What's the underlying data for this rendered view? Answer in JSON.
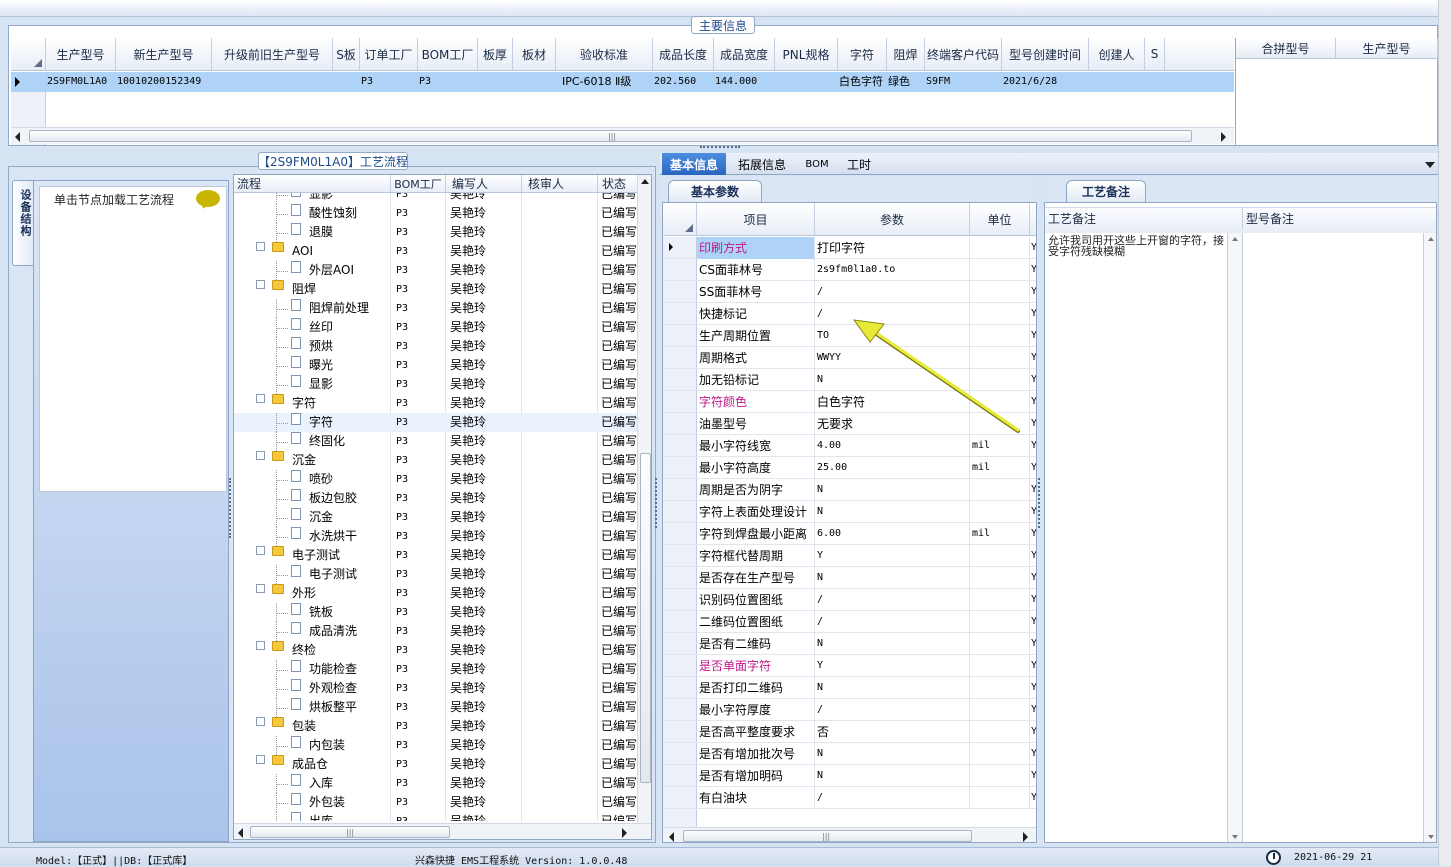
{
  "main_info": {
    "title": "主要信息",
    "columns": [
      "生产型号",
      "新生产型号",
      "升级前旧生产型号",
      "S板",
      "订单工厂",
      "BOM工厂",
      "板厚",
      "板材",
      "验收标准",
      "成品长度",
      "成品宽度",
      "PNL规格",
      "字符",
      "阻焊",
      "终端客户代码",
      "型号创建时间",
      "创建人",
      "S"
    ],
    "row": {
      "prod_model": "2S9FM0L1A0",
      "new_model": "10010200152349",
      "old_model": "",
      "s_board": "",
      "order_factory": "P3",
      "bom_factory": "P3",
      "thickness": "",
      "material": "",
      "standard": "IPC-6018 Ⅱ级",
      "length": "202.560",
      "width": "144.000",
      "pnl": "",
      "char": "白色字符",
      "mask": "绿色",
      "customer": "S9FM",
      "created": "2021/6/28",
      "creator": ""
    },
    "combo_columns": [
      "合拼型号",
      "生产型号"
    ]
  },
  "process": {
    "title": "【2S9FM0L1A0】工艺流程",
    "side_tab": "设备结构",
    "node_hint": "单击节点加载工艺流程",
    "columns": [
      "流程",
      "BOM工厂",
      "编写人",
      "核审人",
      "状态"
    ],
    "rows": [
      {
        "name": "显影",
        "type": "doc",
        "level": 1,
        "bom": "P3",
        "writer": "吴艳玲",
        "reviewer": "",
        "status": "已编写"
      },
      {
        "name": "酸性蚀刻",
        "type": "doc",
        "level": 1,
        "bom": "P3",
        "writer": "吴艳玲",
        "reviewer": "",
        "status": "已编写"
      },
      {
        "name": "退膜",
        "type": "doc",
        "level": 1,
        "bom": "P3",
        "writer": "吴艳玲",
        "reviewer": "",
        "status": "已编写"
      },
      {
        "name": "AOI",
        "type": "folder",
        "level": 0,
        "bom": "P3",
        "writer": "吴艳玲",
        "reviewer": "",
        "status": "已编写"
      },
      {
        "name": "外层AOI",
        "type": "doc",
        "level": 1,
        "bom": "P3",
        "writer": "吴艳玲",
        "reviewer": "",
        "status": "已编写"
      },
      {
        "name": "阻焊",
        "type": "folder",
        "level": 0,
        "bom": "P3",
        "writer": "吴艳玲",
        "reviewer": "",
        "status": "已编写"
      },
      {
        "name": "阻焊前处理",
        "type": "doc",
        "level": 1,
        "bom": "P3",
        "writer": "吴艳玲",
        "reviewer": "",
        "status": "已编写"
      },
      {
        "name": "丝印",
        "type": "doc",
        "level": 1,
        "bom": "P3",
        "writer": "吴艳玲",
        "reviewer": "",
        "status": "已编写"
      },
      {
        "name": "预烘",
        "type": "doc",
        "level": 1,
        "bom": "P3",
        "writer": "吴艳玲",
        "reviewer": "",
        "status": "已编写"
      },
      {
        "name": "曝光",
        "type": "doc",
        "level": 1,
        "bom": "P3",
        "writer": "吴艳玲",
        "reviewer": "",
        "status": "已编写"
      },
      {
        "name": "显影",
        "type": "doc",
        "level": 1,
        "bom": "P3",
        "writer": "吴艳玲",
        "reviewer": "",
        "status": "已编写"
      },
      {
        "name": "字符",
        "type": "folder",
        "level": 0,
        "bom": "P3",
        "writer": "吴艳玲",
        "reviewer": "",
        "status": "已编写"
      },
      {
        "name": "字符",
        "type": "doc",
        "level": 1,
        "bom": "P3",
        "writer": "吴艳玲",
        "reviewer": "",
        "status": "已编写"
      },
      {
        "name": "终固化",
        "type": "doc",
        "level": 1,
        "bom": "P3",
        "writer": "吴艳玲",
        "reviewer": "",
        "status": "已编写"
      },
      {
        "name": "沉金",
        "type": "folder",
        "level": 0,
        "bom": "P3",
        "writer": "吴艳玲",
        "reviewer": "",
        "status": "已编写"
      },
      {
        "name": "喷砂",
        "type": "doc",
        "level": 1,
        "bom": "P3",
        "writer": "吴艳玲",
        "reviewer": "",
        "status": "已编写"
      },
      {
        "name": "板边包胶",
        "type": "doc",
        "level": 1,
        "bom": "P3",
        "writer": "吴艳玲",
        "reviewer": "",
        "status": "已编写"
      },
      {
        "name": "沉金",
        "type": "doc",
        "level": 1,
        "bom": "P3",
        "writer": "吴艳玲",
        "reviewer": "",
        "status": "已编写"
      },
      {
        "name": "水洗烘干",
        "type": "doc",
        "level": 1,
        "bom": "P3",
        "writer": "吴艳玲",
        "reviewer": "",
        "status": "已编写"
      },
      {
        "name": "电子测试",
        "type": "folder",
        "level": 0,
        "bom": "P3",
        "writer": "吴艳玲",
        "reviewer": "",
        "status": "已编写"
      },
      {
        "name": "电子测试",
        "type": "doc",
        "level": 1,
        "bom": "P3",
        "writer": "吴艳玲",
        "reviewer": "",
        "status": "已编写"
      },
      {
        "name": "外形",
        "type": "folder",
        "level": 0,
        "bom": "P3",
        "writer": "吴艳玲",
        "reviewer": "",
        "status": "已编写"
      },
      {
        "name": "铣板",
        "type": "doc",
        "level": 1,
        "bom": "P3",
        "writer": "吴艳玲",
        "reviewer": "",
        "status": "已编写"
      },
      {
        "name": "成品清洗",
        "type": "doc",
        "level": 1,
        "bom": "P3",
        "writer": "吴艳玲",
        "reviewer": "",
        "status": "已编写"
      },
      {
        "name": "终检",
        "type": "folder",
        "level": 0,
        "bom": "P3",
        "writer": "吴艳玲",
        "reviewer": "",
        "status": "已编写"
      },
      {
        "name": "功能检查",
        "type": "doc",
        "level": 1,
        "bom": "P3",
        "writer": "吴艳玲",
        "reviewer": "",
        "status": "已编写"
      },
      {
        "name": "外观检查",
        "type": "doc",
        "level": 1,
        "bom": "P3",
        "writer": "吴艳玲",
        "reviewer": "",
        "status": "已编写"
      },
      {
        "name": "烘板整平",
        "type": "doc",
        "level": 1,
        "bom": "P3",
        "writer": "吴艳玲",
        "reviewer": "",
        "status": "已编写"
      },
      {
        "name": "包装",
        "type": "folder",
        "level": 0,
        "bom": "P3",
        "writer": "吴艳玲",
        "reviewer": "",
        "status": "已编写"
      },
      {
        "name": "内包装",
        "type": "doc",
        "level": 1,
        "bom": "P3",
        "writer": "吴艳玲",
        "reviewer": "",
        "status": "已编写"
      },
      {
        "name": "成品仓",
        "type": "folder",
        "level": 0,
        "bom": "P3",
        "writer": "吴艳玲",
        "reviewer": "",
        "status": "已编写"
      },
      {
        "name": "入库",
        "type": "doc",
        "level": 1,
        "bom": "P3",
        "writer": "吴艳玲",
        "reviewer": "",
        "status": "已编写"
      },
      {
        "name": "外包装",
        "type": "doc",
        "level": 1,
        "bom": "P3",
        "writer": "吴艳玲",
        "reviewer": "",
        "status": "已编写"
      },
      {
        "name": "出库",
        "type": "doc",
        "level": 1,
        "bom": "P3",
        "writer": "吴艳玲",
        "reviewer": "",
        "status": "已编写"
      }
    ]
  },
  "tabs": [
    "基本信息",
    "拓展信息",
    "BOM",
    "工时"
  ],
  "basic": {
    "title": "基本参数",
    "columns": [
      "项目",
      "参数",
      "单位"
    ],
    "rows": [
      {
        "item": "印刷方式",
        "value": "打印字符",
        "unit": "",
        "flag": "Y",
        "pink": true
      },
      {
        "item": "CS面菲林号",
        "value": "2s9fm0l1a0.to",
        "unit": "",
        "flag": "Y",
        "pink": false
      },
      {
        "item": "SS面菲林号",
        "value": "/",
        "unit": "",
        "flag": "Y",
        "pink": false
      },
      {
        "item": "快捷标记",
        "value": "/",
        "unit": "",
        "flag": "Y",
        "pink": false
      },
      {
        "item": "生产周期位置",
        "value": "TO",
        "unit": "",
        "flag": "Y",
        "pink": false
      },
      {
        "item": "周期格式",
        "value": "WWYY",
        "unit": "",
        "flag": "Y",
        "pink": false
      },
      {
        "item": "加无铅标记",
        "value": "N",
        "unit": "",
        "flag": "Y",
        "pink": false
      },
      {
        "item": "字符颜色",
        "value": "白色字符",
        "unit": "",
        "flag": "Y",
        "pink": true
      },
      {
        "item": "油墨型号",
        "value": "无要求",
        "unit": "",
        "flag": "Y",
        "pink": false
      },
      {
        "item": "最小字符线宽",
        "value": "4.00",
        "unit": "mil",
        "flag": "Y",
        "pink": false
      },
      {
        "item": "最小字符高度",
        "value": "25.00",
        "unit": "mil",
        "flag": "Y",
        "pink": false
      },
      {
        "item": "周期是否为阴字",
        "value": "N",
        "unit": "",
        "flag": "Y",
        "pink": false
      },
      {
        "item": "字符上表面处理设计",
        "value": "N",
        "unit": "",
        "flag": "Y",
        "pink": false
      },
      {
        "item": "字符到焊盘最小距离",
        "value": "6.00",
        "unit": "mil",
        "flag": "Y",
        "pink": false
      },
      {
        "item": "字符框代替周期",
        "value": "Y",
        "unit": "",
        "flag": "Y",
        "pink": false
      },
      {
        "item": "是否存在生产型号",
        "value": "N",
        "unit": "",
        "flag": "Y",
        "pink": false
      },
      {
        "item": "识别码位置图纸",
        "value": "/",
        "unit": "",
        "flag": "Y",
        "pink": false
      },
      {
        "item": "二维码位置图纸",
        "value": "/",
        "unit": "",
        "flag": "Y",
        "pink": false
      },
      {
        "item": "是否有二维码",
        "value": "N",
        "unit": "",
        "flag": "Y",
        "pink": false
      },
      {
        "item": "是否单面字符",
        "value": "Y",
        "unit": "",
        "flag": "Y",
        "pink": true
      },
      {
        "item": "是否打印二维码",
        "value": "N",
        "unit": "",
        "flag": "Y",
        "pink": false
      },
      {
        "item": "最小字符厚度",
        "value": "/",
        "unit": "",
        "flag": "Y",
        "pink": false
      },
      {
        "item": "是否高平整度要求",
        "value": "否",
        "unit": "",
        "flag": "Y",
        "pink": false
      },
      {
        "item": "是否有增加批次号",
        "value": "N",
        "unit": "",
        "flag": "Y",
        "pink": false
      },
      {
        "item": "是否有增加明码",
        "value": "N",
        "unit": "",
        "flag": "Y",
        "pink": false
      },
      {
        "item": "有白油块",
        "value": "/",
        "unit": "",
        "flag": "Y",
        "pink": false
      }
    ]
  },
  "notes": {
    "title": "工艺备注",
    "columns": [
      "工艺备注",
      "型号备注"
    ],
    "process_note": "允许我司用开这些上开窗的字符，接受字符残缺模糊"
  },
  "status_bar": {
    "left": "Model:【正式】||DB:【正式库】",
    "center": "兴森快捷 EMS工程系统 Version: 1.0.0.48",
    "right": "2021-06-29 21"
  },
  "colors": {
    "accent": "#2f6fc6",
    "selected_row": "#aed3f6",
    "pink_label": "#c0178a",
    "arrow": "#e8ea3a"
  }
}
